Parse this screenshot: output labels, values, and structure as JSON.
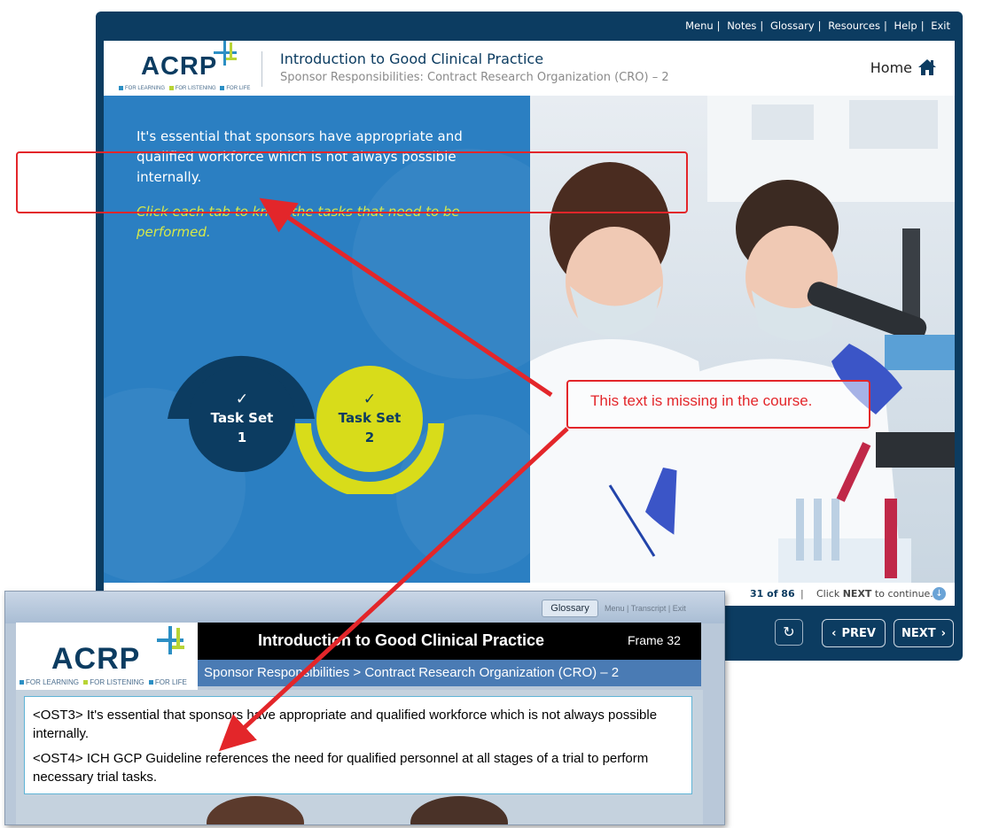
{
  "player": {
    "top_nav": [
      "Menu",
      "Notes",
      "Glossary",
      "Resources",
      "Help",
      "Exit"
    ],
    "logo": {
      "word": "ACRP",
      "tagline": [
        "FOR LEARNING",
        "FOR LISTENING",
        "FOR LIFE"
      ]
    },
    "course_title": "Introduction to Good Clinical Practice",
    "course_subtitle": "Sponsor Responsibilities: Contract Research Organization (CRO) – 2",
    "home_label": "Home",
    "intro_text": "It's essential that sponsors have appropriate and qualified workforce which is not always possible internally.",
    "instruction_text": "Click each tab to know the tasks that need to be performed.",
    "tabs": [
      {
        "check": "✓",
        "line1": "Task Set",
        "line2": "1"
      },
      {
        "check": "✓",
        "line1": "Task Set",
        "line2": "2"
      }
    ],
    "page_counter": "31 of 86",
    "page_sep": "|",
    "continue_prefix": "Click ",
    "continue_bold": "NEXT",
    "continue_suffix": " to continue.",
    "prev_label": "PREV",
    "next_label": "NEXT"
  },
  "annotation": {
    "callout_text": "This text is missing in the course."
  },
  "inset": {
    "glossary_label": "Glossary",
    "menu_items": [
      "Menu",
      "Transcript",
      "Exit"
    ],
    "title": "Introduction to Good Clinical Practice",
    "frame_label": "Frame 32",
    "subtitle": "Sponsor Responsibilities > Contract Research Organization (CRO) – 2",
    "ost3": "<OST3> It's essential that sponsors have appropriate and qualified workforce which is not always possible internally.",
    "ost4": "<OST4> ICH GCP Guideline references the need for qualified personnel at all stages of a trial to perform necessary trial tasks."
  },
  "colors": {
    "navy": "#0c3c61",
    "panel_blue": "#2b7fc2",
    "accent_yellow": "#d8dc1a",
    "annotation_red": "#e3262a"
  }
}
